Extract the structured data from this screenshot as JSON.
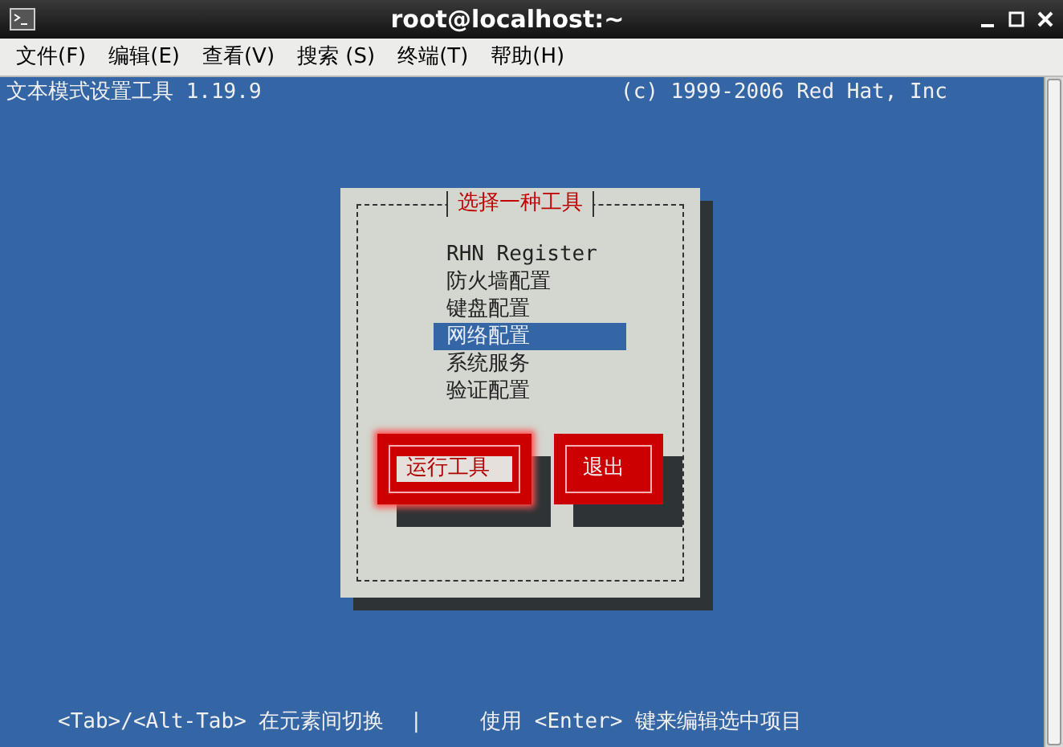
{
  "window": {
    "title": "root@localhost:~"
  },
  "menu": [
    "文件(F)",
    "编辑(E)",
    "查看(V)",
    "搜索 (S)",
    "终端(T)",
    "帮助(H)"
  ],
  "terminal": {
    "header_left": "文本模式设置工具 1.19.9",
    "header_right": "(c) 1999-2006 Red Hat, Inc",
    "dialog": {
      "title": "选择一种工具",
      "items": [
        {
          "label": "RHN Register",
          "selected": false
        },
        {
          "label": "防火墙配置",
          "selected": false
        },
        {
          "label": "键盘配置",
          "selected": false
        },
        {
          "label": "网络配置",
          "selected": true
        },
        {
          "label": "系统服务",
          "selected": false
        },
        {
          "label": "验证配置",
          "selected": false
        }
      ],
      "buttons": [
        {
          "label": "运行工具",
          "selected": true
        },
        {
          "label": "退出",
          "selected": false
        }
      ]
    },
    "status": [
      "<Tab>/<Alt-Tab> 在元素间切换",
      "|",
      "使用 <Enter> 键来编辑选中项目"
    ]
  }
}
